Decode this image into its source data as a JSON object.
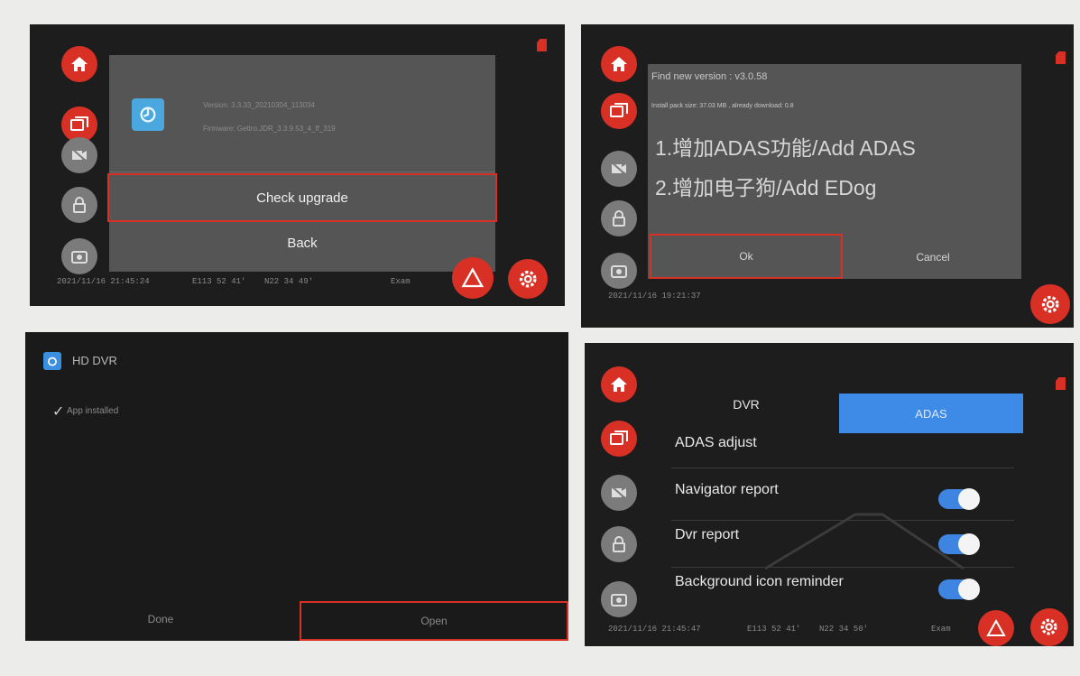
{
  "colors": {
    "accent": "#d93025",
    "toggle_on": "#3d85e0",
    "tab_active": "#3d8be6",
    "panel_bg": "#1d1d1d",
    "dialog_bg": "#555555"
  },
  "panel1": {
    "version_line": "Version: 3.3.33_20210304_113034",
    "firmware_line": "Firmware: Gettro.JDR_3.3.9.53_4_ff_319",
    "check_upgrade_label": "Check upgrade",
    "back_label": "Back",
    "status_time": "2021/11/16 21:45:24",
    "status_coord1": "E113 52 41'",
    "status_coord2": "N22 34 49'",
    "status_extra": "Exam"
  },
  "panel2": {
    "title": "Find new version : v3.0.58",
    "subtitle": "Install pack size: 37.03 MB , already download: 0.8",
    "item1": "1.增加ADAS功能/Add ADAS",
    "item2": "2.增加电子狗/Add EDog",
    "ok_label": "Ok",
    "cancel_label": "Cancel",
    "status_time": "2021/11/16 19:21:37"
  },
  "panel3": {
    "app_name": "HD DVR",
    "installed_text": "App installed",
    "done_label": "Done",
    "open_label": "Open"
  },
  "panel4": {
    "tabs": [
      "DVR",
      "ADAS"
    ],
    "active_tab": "ADAS",
    "adas_adjust_label": "ADAS adjust",
    "settings": [
      {
        "label": "Navigator report",
        "enabled": true
      },
      {
        "label": "Dvr report",
        "enabled": true
      },
      {
        "label": "Background icon reminder",
        "enabled": true
      }
    ],
    "status_time": "2021/11/16 21:45:47",
    "status_coord1": "E113 52 41'",
    "status_coord2": "N22 34 50'",
    "status_extra": "Exam"
  },
  "icons": [
    "home-icon",
    "windows-icon",
    "video-off-icon",
    "lock-icon",
    "camera-icon",
    "sd-card-icon",
    "alert-icon",
    "settings-gear-icon"
  ]
}
